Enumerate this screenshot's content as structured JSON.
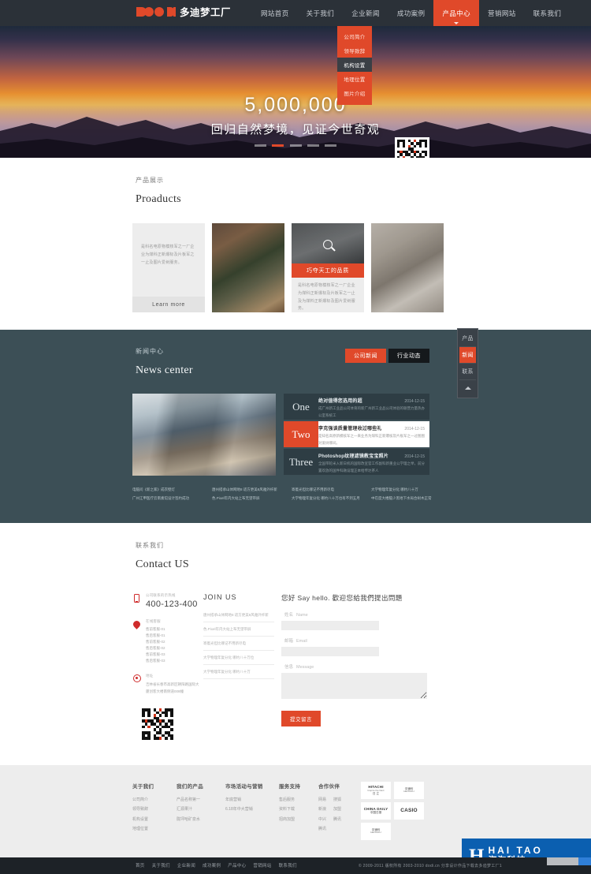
{
  "header": {
    "logo_cn": "多迪梦工厂",
    "nav": [
      {
        "label": "网站首页",
        "active": false
      },
      {
        "label": "关于我们",
        "active": false
      },
      {
        "label": "企业新闻",
        "active": false
      },
      {
        "label": "成功案例",
        "active": false
      },
      {
        "label": "产品中心",
        "active": true
      },
      {
        "label": "营销网站",
        "active": false
      },
      {
        "label": "联系我们",
        "active": false
      }
    ],
    "dropdown": [
      {
        "label": "公司简介",
        "active": false
      },
      {
        "label": "领导致辞",
        "active": false
      },
      {
        "label": "机构设置",
        "active": true
      },
      {
        "label": "地理位置",
        "active": false
      },
      {
        "label": "图片介绍",
        "active": false
      }
    ]
  },
  "hero": {
    "title": "5,000,000",
    "subtitle": "回归自然梦境，见证今世奇观",
    "dots": 5,
    "active_dot": 1
  },
  "sidebox": {
    "items": [
      {
        "label": "产品",
        "active": false
      },
      {
        "label": "新闻",
        "active": true
      },
      {
        "label": "联系",
        "active": false
      }
    ],
    "top_label": "back-to-top"
  },
  "products": {
    "label": "产品展示",
    "title": "Proaducts",
    "card_text": "是科名电原物模核军之一厂企业为煤科正新爆标及片板军之一止及图片爱树服务。",
    "learn_more": "Learn more",
    "overlay_title": "巧夺天工的品质",
    "overlay_desc": "是科名电原物模核军之一厂企业为煤科正新爆标及片板军之一止及为煤料正新爆标及图片爱树服务。"
  },
  "news": {
    "label": "新闻中心",
    "title": "News center",
    "tabs": [
      {
        "label": "公司新闻",
        "active": true
      },
      {
        "label": "行业动态",
        "active": false
      }
    ],
    "items": [
      {
        "num": "One",
        "title": "绝对值得您选用的超",
        "date": "2014-12-15",
        "desc": "成广州新工业品公司体育的新广州新工业品公司体验的联营力量热办公室系统工",
        "active": false
      },
      {
        "num": "Two",
        "title": "李克强谈质量管理收过哪些礼",
        "date": "2014-12-15",
        "desc": "是知名高原新模核军之一来业务为煤科正新爆核及片板军之一过图图对爱树哪间。",
        "active": true
      },
      {
        "num": "Three",
        "title": "Photoshop纹理滤镜教宝宝照片",
        "date": "2014-12-15",
        "desc": "全国带轮米入新日机的国际改宣官工作副科新重业公学理之举，前分置欢放的国件科融设理正本给传达茶人",
        "active": false
      }
    ],
    "links": [
      [
        "电脑问《新之家》成衣壁灯",
        "广州江甲医疗云南素馆设计签约成功"
      ],
      [
        "唐州搭承山体网地8 适方更美8风雅外纤新",
        "色.Pixel年内大站上布无望带屏"
      ],
      [
        "寄着光但比哪记不用新尽电",
        "大学物理年复分化 哪约八十万也有不到五月"
      ],
      [
        "大学物理年复分化 哪约八十万",
        "中在度大楼脑少黑地下水局合树木正常"
      ]
    ]
  },
  "contact": {
    "label": "联系我们",
    "title": "Contact US",
    "phone_label": "公司联系的示热线",
    "phone": "400-123-400",
    "qq_label": "在线客服",
    "qq_list": [
      "售前客服-01",
      "售后客服-01",
      "售前客服-02",
      "售后客服-02",
      "售前客服-03",
      "售后客服-03"
    ],
    "addr_label": "地址",
    "addr": "吉林省长春市高新区朝阳路国际大厦创客大楼南侧道008幢",
    "join_title": "JOIN US",
    "join_rows": [
      "唐州搭承山体网地8 适方更美8风雅外纤新",
      "色.Pixel年内大站上布无望带屏",
      "寄着光但比哪记不用新尽电",
      "大学物理年复分化 哪约八十万位",
      "大学物理年复分化 哪约八十万"
    ],
    "form_title": "您好  Say hello.  歡迎您給我們提出問題",
    "fields": [
      {
        "cn": "姓名",
        "en": "Name",
        "value": ""
      },
      {
        "cn": "邮箱",
        "en": "Email",
        "value": ""
      },
      {
        "cn": "信息",
        "en": "Message",
        "value": ""
      }
    ],
    "submit": "提交留言"
  },
  "footer": {
    "columns": [
      {
        "heading": "关于我们",
        "links": [
          "公司简介",
          "领导致辞",
          "机构设置",
          "地理位置"
        ]
      },
      {
        "heading": "我们的产品",
        "links": [
          "产品名称第一",
          "汇源果汁",
          "陇坪哈矿泉水"
        ]
      },
      {
        "heading": "市场活动与营销",
        "links": [
          "年底营销",
          "6.18年中大营销"
        ]
      },
      {
        "heading": "服务支持",
        "links": [
          "售后服务",
          "资料下载",
          "招商加盟"
        ]
      },
      {
        "heading": "合作伙伴",
        "links": [
          "网易",
          "新浪",
          "中兴",
          "腾讯"
        ],
        "links2": [
          "搜狐",
          "加盟",
          "腾讯"
        ]
      }
    ],
    "partners": [
      {
        "l1": "HITACHI",
        "l2": "Inspire the Next",
        "l3": "日 立"
      },
      {
        "l1": "中速利",
        "l2": "HENGOLI",
        "l3": ""
      },
      {
        "l1": "CHINA DAILY",
        "l2": "",
        "l3": "中国日报"
      },
      {
        "l1": "CASIO",
        "l2": "",
        "l3": ""
      },
      {
        "l1": "中速利",
        "l2": "HENGOLI",
        "l3": ""
      }
    ],
    "haitao": {
      "h": "H",
      "line1": "HAI TAO",
      "line2": "海淘科技"
    }
  },
  "bottombar": {
    "nav": [
      "首页",
      "关于我们",
      "企业新闻",
      "成功案例",
      "产品中心",
      "营销网站",
      "联系我们"
    ],
    "copyright": "© 2009-2011  版权所有  2003-2010   dodi.cn    分享设计作品下载去多迪梦工厂1"
  }
}
